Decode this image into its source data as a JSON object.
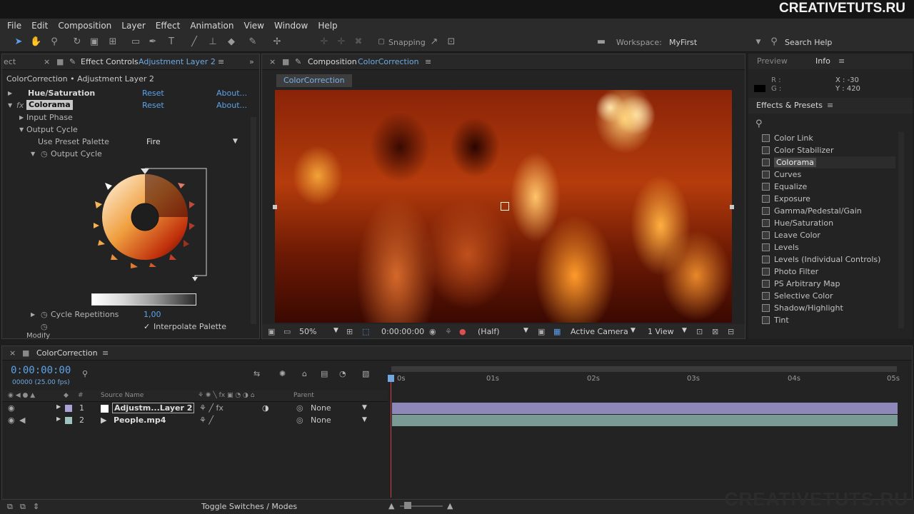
{
  "watermark": "CREATIVETUTS.RU",
  "menu": [
    "File",
    "Edit",
    "Composition",
    "Layer",
    "Effect",
    "Animation",
    "View",
    "Window",
    "Help"
  ],
  "toolbar": {
    "snapping": "Snapping",
    "workspace_label": "Workspace:",
    "workspace_value": "MyFirst",
    "search_help": "Search Help"
  },
  "effect_controls": {
    "left_tab": "ect",
    "tab_label": "Effect Controls",
    "tab_layer": "Adjustment Layer 2",
    "breadcrumb": "ColorCorrection • Adjustment Layer 2",
    "effects": [
      {
        "name": "Hue/Saturation",
        "reset": "Reset",
        "about": "About..."
      },
      {
        "name": "Colorama",
        "reset": "Reset",
        "about": "About..."
      }
    ],
    "input_phase": "Input Phase",
    "output_cycle": "Output Cycle",
    "use_preset_palette": "Use Preset Palette",
    "preset_value": "Fire",
    "output_cycle_sub": "Output Cycle",
    "cycle_repetitions": "Cycle Repetitions",
    "cycle_value": "1,00",
    "interpolate_palette": "Interpolate Palette",
    "interpolate_checked": "✓",
    "modify": "Modify"
  },
  "composition": {
    "tab_label": "Composition",
    "tab_name": "ColorCorrection",
    "badge": "ColorCorrection",
    "zoom": "50%",
    "time": "0:00:00:00",
    "resolution": "(Half)",
    "camera": "Active Camera",
    "views": "1 View"
  },
  "right_panel": {
    "preview_tab": "Preview",
    "info_tab": "Info",
    "info_r": "R :",
    "info_g": "G :",
    "info_x": "X : -30",
    "info_y": "Y : 420",
    "effects_presets": "Effects & Presets",
    "search_glyph": "⚲",
    "items": [
      "Color Link",
      "Color Stabilizer",
      "Colorama",
      "Curves",
      "Equalize",
      "Exposure",
      "Gamma/Pedestal/Gain",
      "Hue/Saturation",
      "Leave Color",
      "Levels",
      "Levels (Individual Controls)",
      "Photo Filter",
      "PS Arbitrary Map",
      "Selective Color",
      "Shadow/Highlight",
      "Tint"
    ],
    "selected": "Colorama"
  },
  "timeline": {
    "tab_name": "ColorCorrection",
    "timecode": "0:00:00:00",
    "fps": "00000 (25.00 fps)",
    "col_hash": "#",
    "col_source": "Source Name",
    "col_parent": "Parent",
    "ruler": [
      "0s",
      "01s",
      "02s",
      "03s",
      "04s",
      "05s"
    ],
    "layers": [
      {
        "num": "1",
        "name": "Adjustm...Layer 2",
        "parent": "None",
        "color": "#a9a3d8"
      },
      {
        "num": "2",
        "name": "People.mp4",
        "parent": "None",
        "color": "#9ec4bf"
      }
    ],
    "toggle": "Toggle Switches / Modes"
  }
}
